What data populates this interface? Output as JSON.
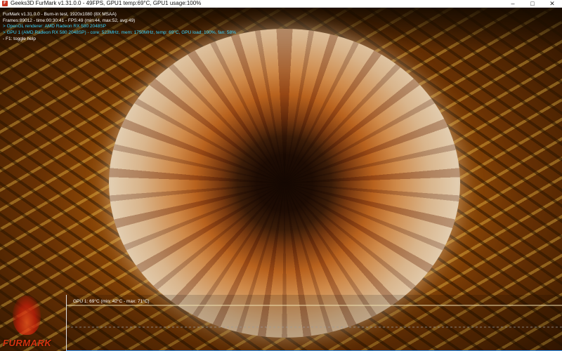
{
  "window": {
    "title": "Geeks3D FurMark v1.31.0.0 - 49FPS, GPU1 temp:69°C, GPU1 usage:100%",
    "icon": "furmark-app-icon",
    "controls": {
      "minimize": "–",
      "maximize": "□",
      "close": "✕"
    }
  },
  "osd": {
    "line1": "FurMark v1.31.0.0 - Burn-in test, 1920x1080 (8X MSAA)",
    "line2": "Frames:89012 - time:00:30:41 - FPS:49 (min:44, max:52, avg:49)",
    "line3": "> OpenGL renderer: AMD Radeon RX 580 2048SP",
    "line4": "> GPU 1 (AMD Radeon RX 580 2048SP) - core: 523MHz, mem: 1750MHz, temp: 69°C, GPU load: 100%, fan: 58%",
    "line5": "- F1: toggle help",
    "colors": {
      "white": "#ffffff",
      "yellow": "#ffe96a",
      "cyan": "#38d4ff"
    }
  },
  "graph": {
    "label": "GPU 1: 69°C (min: 42°C - max: 71°C)",
    "temp_current": 69,
    "temp_min": 42,
    "temp_max": 71,
    "line_color": "#f2e2b0",
    "axis_color": "#3aa0ff"
  },
  "logo": {
    "text": "FURMARK"
  }
}
